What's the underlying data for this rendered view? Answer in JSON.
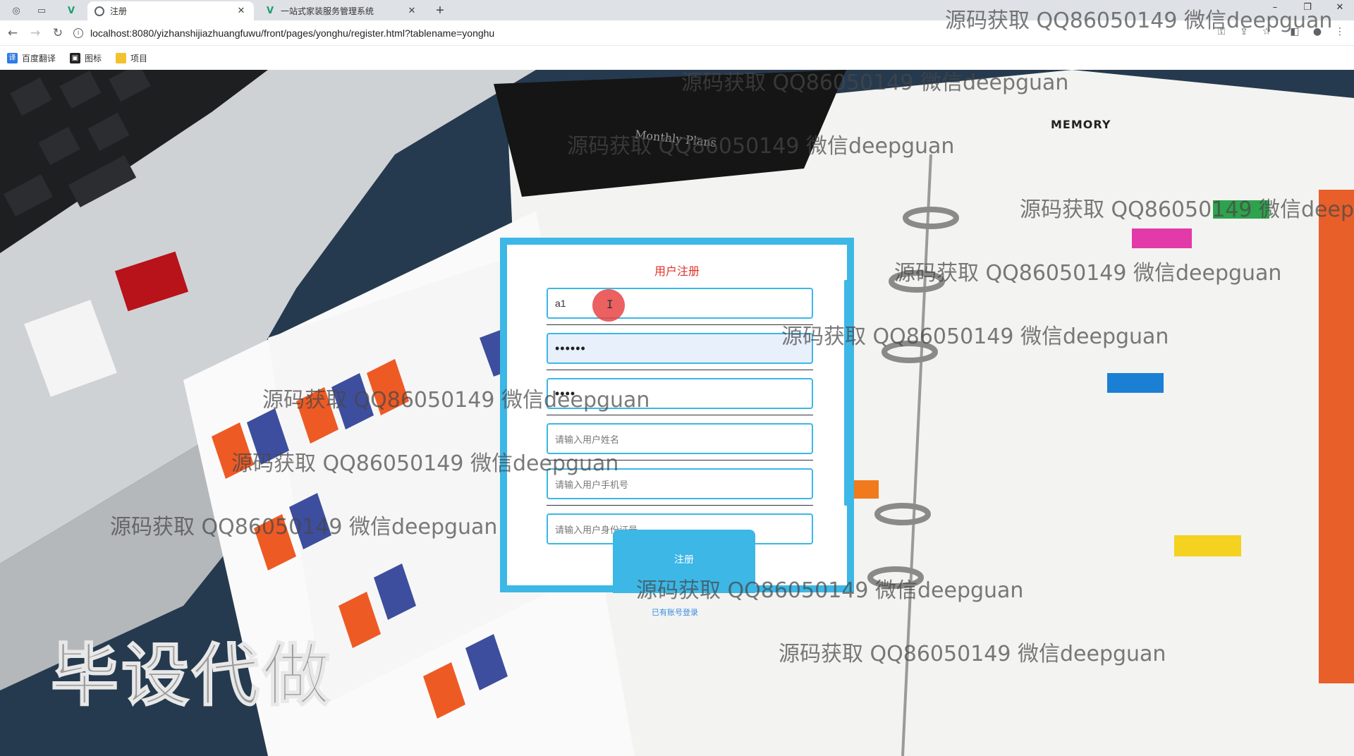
{
  "browser": {
    "tabs": [
      {
        "title": "注册",
        "active": true
      },
      {
        "title": "一站式家装服务管理系统",
        "active": false
      }
    ],
    "new_tab": "+",
    "url": "localhost:8080/yizhanshijiazhuangfuwu/front/pages/yonghu/register.html?tablename=yonghu",
    "bookmarks": [
      {
        "label": "百度翻译",
        "icon": "translate-icon",
        "color": "#2f7ae5"
      },
      {
        "label": "图标",
        "icon": "image-icon",
        "color": "#222222"
      },
      {
        "label": "项目",
        "icon": "folder-icon",
        "color": "#f2c230"
      }
    ]
  },
  "form": {
    "title": "用户注册",
    "fields": [
      {
        "name": "account",
        "value": "a1",
        "placeholder": ""
      },
      {
        "name": "password",
        "value": "••••••",
        "placeholder": ""
      },
      {
        "name": "password2",
        "value": "••••",
        "placeholder": ""
      },
      {
        "name": "username",
        "value": "",
        "placeholder": "请输入用户姓名"
      },
      {
        "name": "phone",
        "value": "",
        "placeholder": "请输入用户手机号"
      },
      {
        "name": "idcard",
        "value": "",
        "placeholder": "请输入用户身份证号"
      }
    ],
    "submit_label": "注册",
    "login_link": "已有账号登录"
  },
  "overlay": {
    "watermark": "源码获取 QQ86050149 微信deepguan",
    "big_text": "毕设代做"
  },
  "colors": {
    "accent": "#3cb7e6",
    "title_red": "#e0312a"
  }
}
